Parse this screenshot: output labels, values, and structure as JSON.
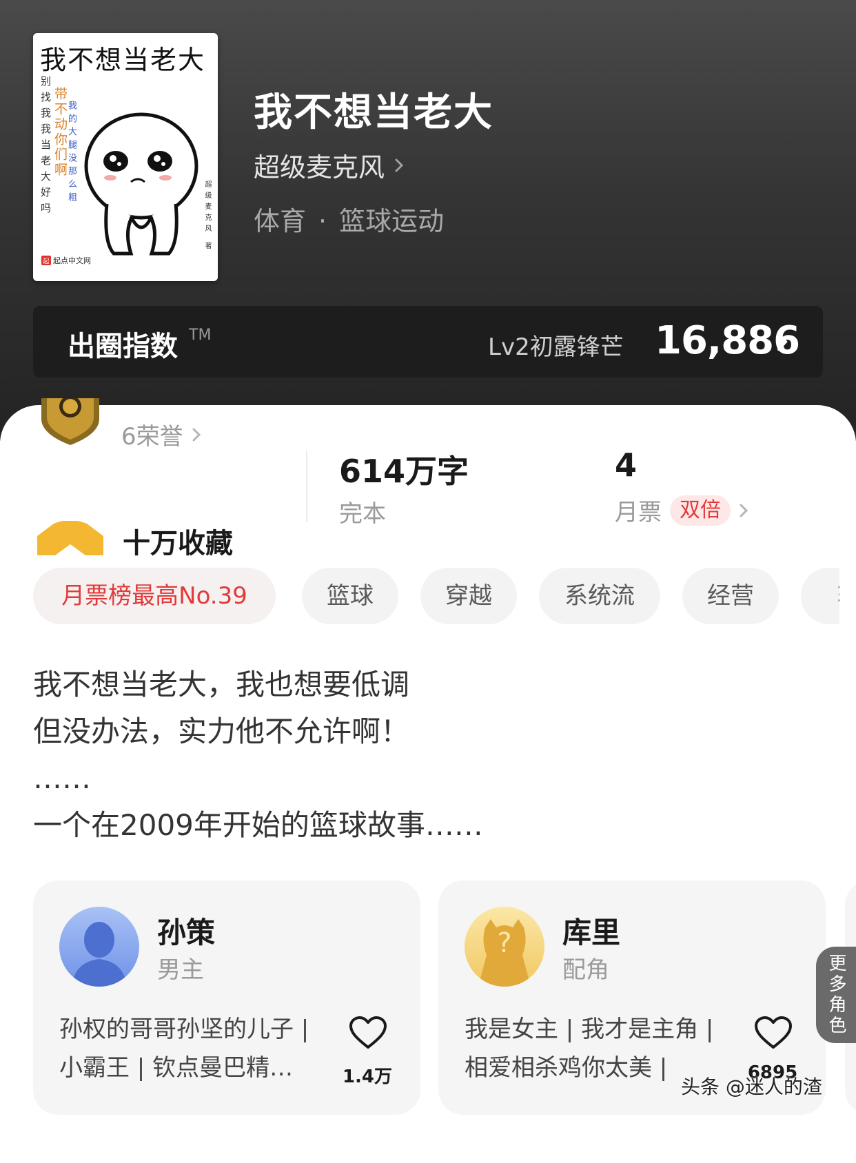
{
  "book": {
    "cover_title": "我不想当老大",
    "cover_line1": "别找我我当老大好吗",
    "cover_line2": "带不动你们啊",
    "cover_line3": "我的大腿没那么粗",
    "cover_author": "超级麦克风 著",
    "cover_publisher": "起点中文网",
    "cover_publisher_mark": "起",
    "title": "我不想当老大",
    "author": "超级麦克风",
    "category": "体育",
    "subcategory": "篮球运动",
    "category_separator": "·"
  },
  "index": {
    "label": "出圈指数",
    "tm": "TM",
    "level": "Lv2初露锋芒",
    "value": "16,886"
  },
  "honor": {
    "text": "6荣誉"
  },
  "stats": {
    "words": "614万字",
    "status": "完本",
    "votes": "4",
    "votes_label": "月票",
    "votes_badge": "双倍"
  },
  "favorites": {
    "text": "十万收藏"
  },
  "tags": [
    "月票榜最高No.39",
    "篮球",
    "穿越",
    "系统流",
    "经营",
    "轻"
  ],
  "description": [
    "我不想当老大，我也想要低调",
    "但没办法，实力他不允许啊！",
    "……",
    "一个在2009年开始的篮球故事……"
  ],
  "characters": [
    {
      "name": "孙策",
      "role": "男主",
      "desc_line1": "孙权的哥哥孙坚的儿子 | ",
      "desc_line2": "小霸王 | 钦点曼巴精…",
      "likes": "1.4万"
    },
    {
      "name": "库里",
      "role": "配角",
      "desc_line1": "我是女主 | 我才是主角 | ",
      "desc_line2": "相爱相杀鸡你太美 |",
      "likes": "6895"
    }
  ],
  "more_roles": "更多角色",
  "watermark": "头条 @迷人的渣",
  "colors": {
    "accent_red": "#e23a3a",
    "gold": "#f3b731",
    "dark_bg": "#2a2a2a"
  }
}
